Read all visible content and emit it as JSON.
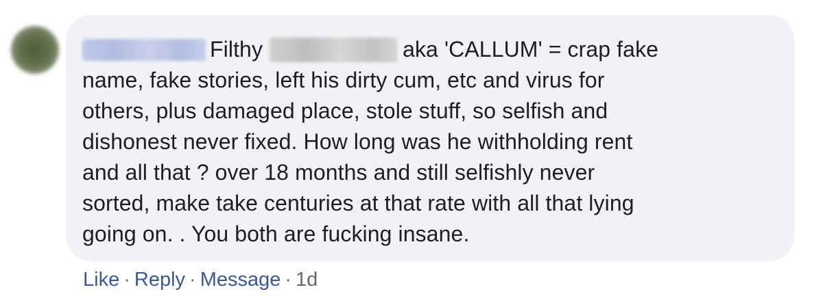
{
  "comment": {
    "lines": [
      "Filthy",
      "aka 'CALLUM' = crap fake",
      "name, fake stories, left his dirty cum, etc and virus for",
      "others, plus damaged place, stole stuff, so selfish and",
      "dishonest never fixed. How long was he withholding rent",
      "and all that ? over 18 months and still selfishly never",
      "sorted, make take centuries at that rate with all that lying",
      "going on. . You both are fucking insane."
    ]
  },
  "actions": {
    "like": "Like",
    "reply": "Reply",
    "message": "Message",
    "separator": "·",
    "timestamp": "1d"
  },
  "colors": {
    "bubble_bg": "#f0f2f5",
    "text": "#1c1e21",
    "link": "#385898",
    "meta": "#65676b"
  }
}
